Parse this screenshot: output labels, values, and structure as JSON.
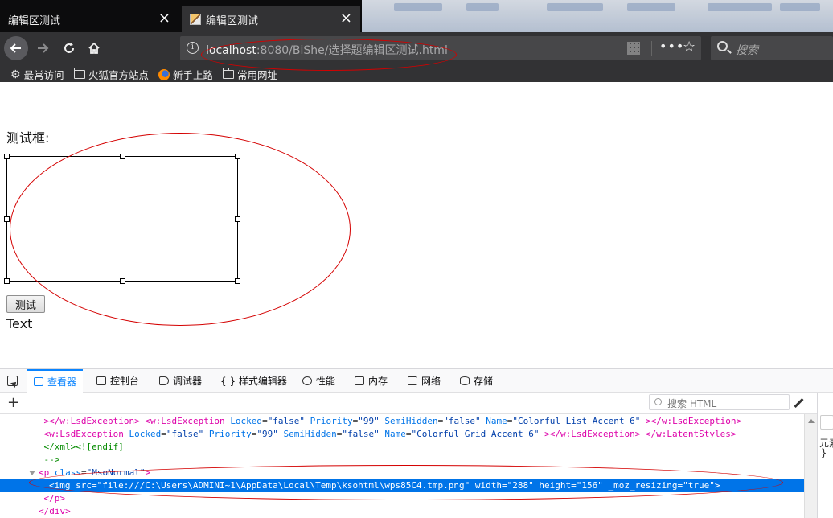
{
  "tabs": [
    {
      "title": "编辑区测试",
      "active": false
    },
    {
      "title": "编辑区测试",
      "active": true
    }
  ],
  "close_glyph": "×",
  "nav": {
    "url_host": "localhost",
    "url_rest": ":8080/BiShe/选择题编辑区测试.html",
    "search_placeholder": "搜索",
    "icons": [
      "back-icon",
      "forward-icon",
      "reload-icon",
      "home-icon",
      "info-icon",
      "qr-code-icon",
      "more-icon",
      "bookmark-star-icon",
      "search-icon"
    ]
  },
  "bookmarks": [
    "最常访问",
    "火狐官方站点",
    "新手上路",
    "常用网址"
  ],
  "page": {
    "label": "测试框:",
    "button": "测试",
    "output": "Text"
  },
  "devtools": {
    "tabs": [
      "查看器",
      "控制台",
      "调试器",
      "{ } 样式编辑器",
      "性能",
      "内存",
      "网络",
      "存储"
    ],
    "selected_tab": "查看器",
    "search_placeholder": "搜索 HTML",
    "side_text": "元素",
    "side_brace": "}"
  },
  "markup_lines": [
    {
      "indent": 5,
      "parts": [
        [
          "t",
          "></w:LsdException> "
        ],
        [
          "t",
          "<w:LsdException "
        ],
        [
          "n",
          "Locked"
        ],
        [
          "p",
          "="
        ],
        [
          "v",
          "\"false\""
        ],
        [
          "n",
          " Priority"
        ],
        [
          "p",
          "="
        ],
        [
          "v",
          "\"99\""
        ],
        [
          "n",
          " SemiHidden"
        ],
        [
          "p",
          "="
        ],
        [
          "v",
          "\"false\""
        ],
        [
          "n",
          " Name"
        ],
        [
          "p",
          "="
        ],
        [
          "v",
          "\"Colorful List Accent 6\""
        ],
        [
          "t",
          " ></w:LsdException>"
        ]
      ]
    },
    {
      "indent": 5,
      "parts": [
        [
          "t",
          "<w:LsdException "
        ],
        [
          "n",
          "Locked"
        ],
        [
          "p",
          "="
        ],
        [
          "v",
          "\"false\""
        ],
        [
          "n",
          " Priority"
        ],
        [
          "p",
          "="
        ],
        [
          "v",
          "\"99\""
        ],
        [
          "n",
          " SemiHidden"
        ],
        [
          "p",
          "="
        ],
        [
          "v",
          "\"false\""
        ],
        [
          "n",
          " Name"
        ],
        [
          "p",
          "="
        ],
        [
          "v",
          "\"Colorful Grid Accent 6\""
        ],
        [
          "t",
          " ></w:LsdException> </w:LatentStyles>"
        ]
      ]
    },
    {
      "indent": 5,
      "parts": [
        [
          "t",
          "</xml><![endif]"
        ]
      ]
    },
    {
      "indent": 5,
      "parts": [
        [
          "t",
          "-->"
        ]
      ]
    },
    {
      "indent": 4,
      "twisty": true,
      "parts": [
        [
          "t",
          "<p "
        ],
        [
          "n",
          "class"
        ],
        [
          "p",
          "="
        ],
        [
          "v",
          "\"MsoNormal\""
        ],
        [
          "t",
          ">"
        ]
      ]
    },
    {
      "indent": 6,
      "selected": true,
      "parts": [
        [
          "t",
          "<img "
        ],
        [
          "n",
          "src"
        ],
        [
          "p",
          "="
        ],
        [
          "v",
          "\"file:///C:\\Users\\ADMINI~1\\AppData\\Local\\Temp\\ksohtml\\wps85C4.tmp.png\""
        ],
        [
          "n",
          " width"
        ],
        [
          "p",
          "="
        ],
        [
          "v",
          "\"288\""
        ],
        [
          "n",
          " height"
        ],
        [
          "p",
          "="
        ],
        [
          "v",
          "\"156\""
        ],
        [
          "n",
          " _moz_resizing"
        ],
        [
          "p",
          "="
        ],
        [
          "v",
          "\"true\""
        ],
        [
          "t",
          ">"
        ]
      ]
    },
    {
      "indent": 5,
      "parts": [
        [
          "t",
          "</p>"
        ]
      ]
    },
    {
      "indent": 4,
      "parts": [
        [
          "t",
          "</div>"
        ]
      ]
    }
  ],
  "colors": {
    "annotation": "#d40000",
    "selection": "#0074e8",
    "devtools_accent": "#0a84ff"
  }
}
